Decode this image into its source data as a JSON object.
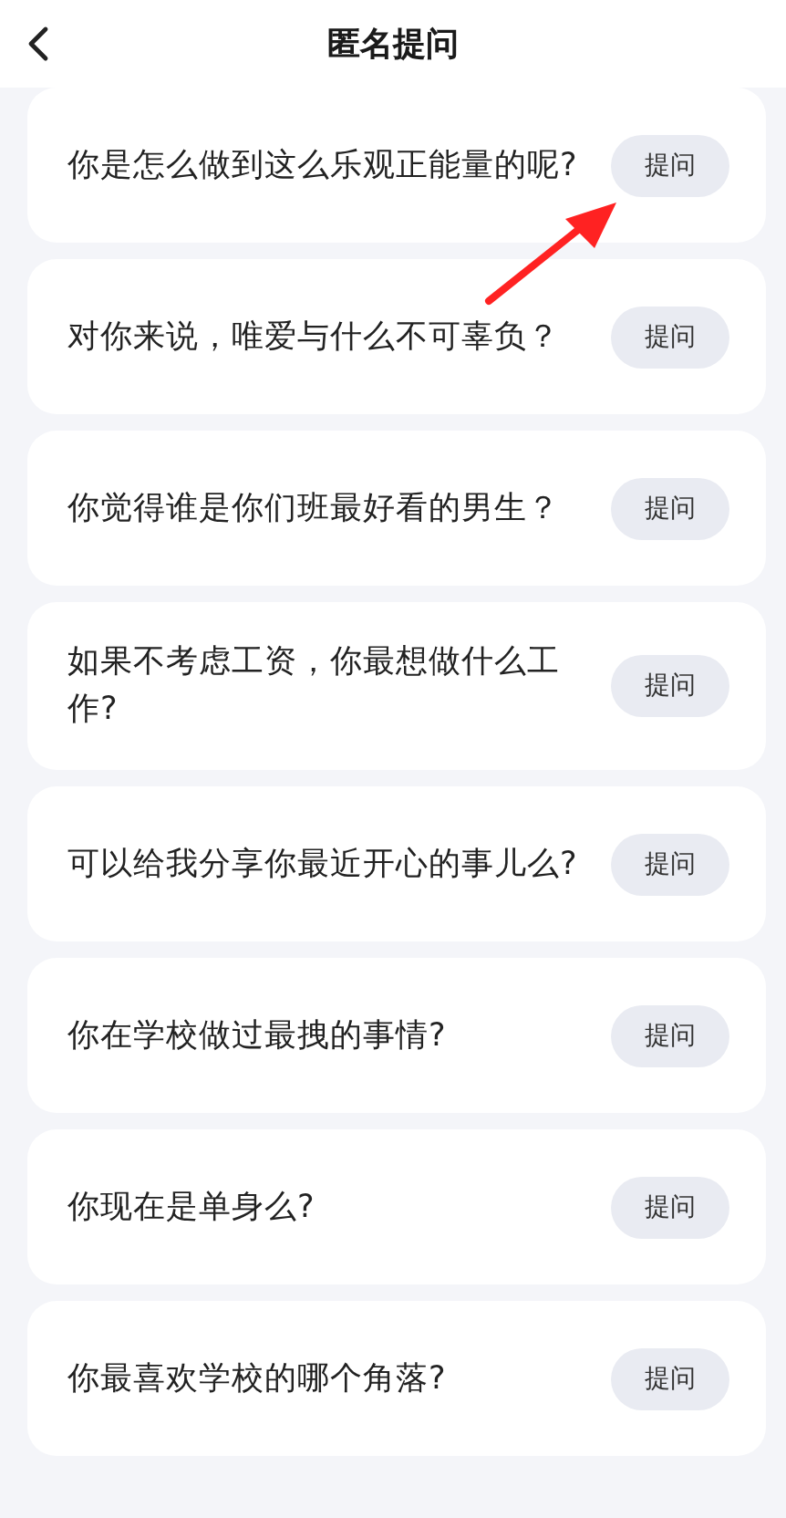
{
  "header": {
    "title": "匿名提问"
  },
  "questions": [
    {
      "text": "你是怎么做到这么乐观正能量的呢?",
      "button": "提问"
    },
    {
      "text": "对你来说，唯爱与什么不可辜负？",
      "button": "提问"
    },
    {
      "text": "你觉得谁是你们班最好看的男生？",
      "button": "提问"
    },
    {
      "text": "如果不考虑工资，你最想做什么工作?",
      "button": "提问"
    },
    {
      "text": "可以给我分享你最近开心的事儿么?",
      "button": "提问"
    },
    {
      "text": "你在学校做过最拽的事情?",
      "button": "提问"
    },
    {
      "text": "你现在是单身么?",
      "button": "提问"
    },
    {
      "text": "你最喜欢学校的哪个角落?",
      "button": "提问"
    }
  ]
}
